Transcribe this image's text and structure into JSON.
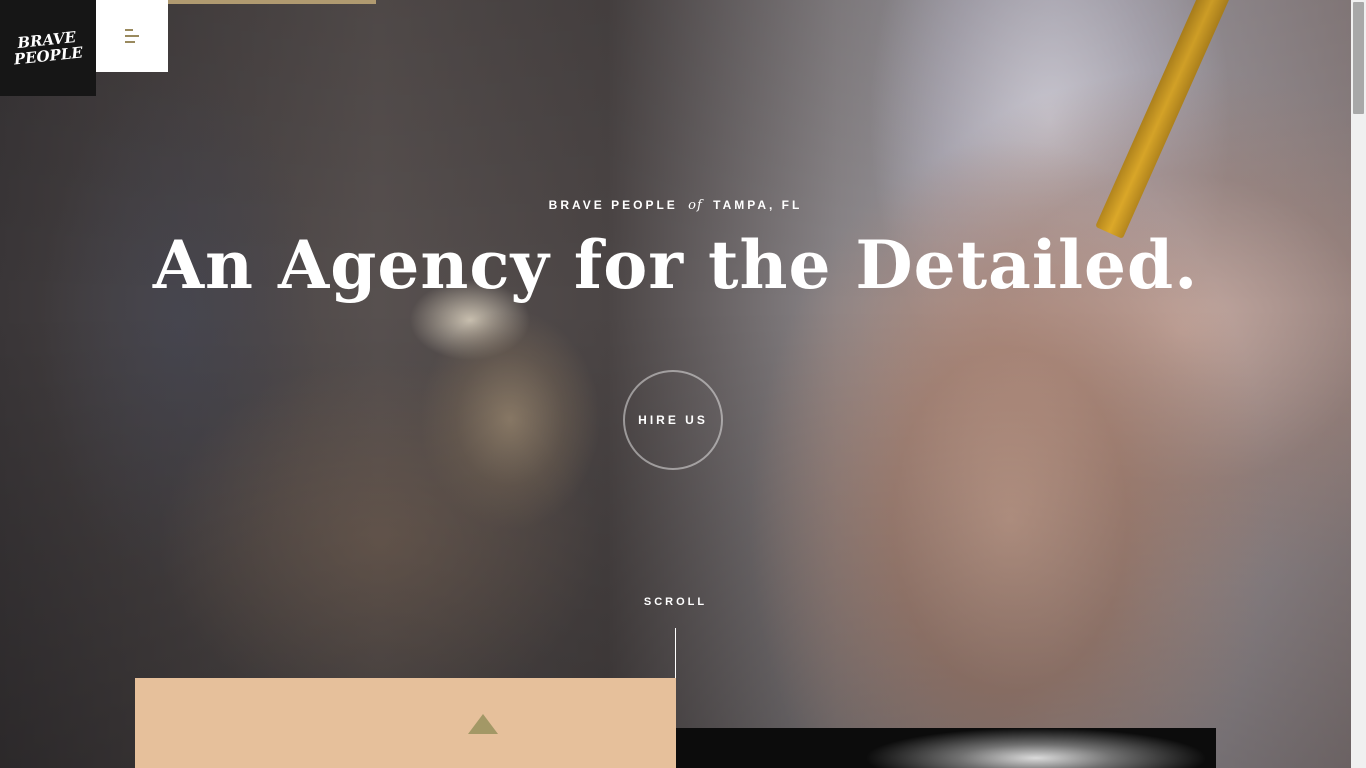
{
  "brand": {
    "logo_text": "BRAVE PEOPLE"
  },
  "hero": {
    "eyebrow_left": "BRAVE PEOPLE",
    "eyebrow_of": "of",
    "eyebrow_right": "TAMPA, FL",
    "headline": "An Agency for the Detailed.",
    "cta_label": "HIRE US",
    "scroll_label": "SCROLL"
  },
  "icons": {
    "menu": "hamburger-menu-icon",
    "up_arrow": "triangle-up-icon"
  },
  "colors": {
    "accent": "#b09a70",
    "peach": "#e6c09b",
    "olive": "#a39866",
    "logo_bg": "#161616"
  }
}
